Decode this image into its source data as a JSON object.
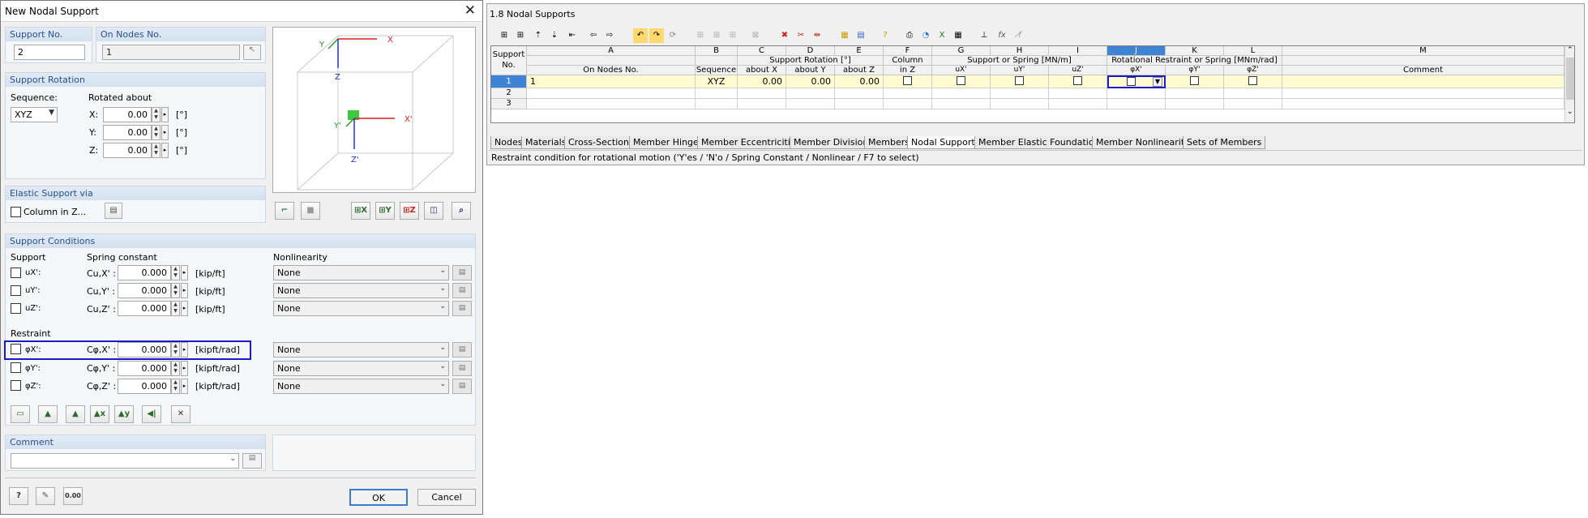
{
  "dialog": {
    "title": "New Nodal Support",
    "support_no_label": "Support No.",
    "support_no_value": "2",
    "on_nodes_label": "On Nodes No.",
    "on_nodes_value": "1",
    "rotation": {
      "title": "Support Rotation",
      "sequence_label": "Sequence:",
      "sequence_value": "XYZ",
      "rotated_about_label": "Rotated about",
      "rows": [
        {
          "axis": "X:",
          "value": "0.00",
          "unit": "[°]"
        },
        {
          "axis": "Y:",
          "value": "0.00",
          "unit": "[°]"
        },
        {
          "axis": "Z:",
          "value": "0.00",
          "unit": "[°]"
        }
      ]
    },
    "axes": {
      "x": "X",
      "y": "Y",
      "z": "Z",
      "xp": "X'",
      "yp": "Y'",
      "zp": "Z'"
    },
    "elastic": {
      "title": "Elastic Support via",
      "column_label": "Column in Z..."
    },
    "conditions": {
      "title": "Support Conditions",
      "support_label": "Support",
      "spring_label": "Spring constant",
      "nonlinearity_label": "Nonlinearity",
      "restraint_label": "Restraint",
      "rows": [
        {
          "dof": "uX':",
          "sym": "Cu,X' :",
          "value": "0.000",
          "unit": "[kip/ft]",
          "nonlin": "None"
        },
        {
          "dof": "uY':",
          "sym": "Cu,Y' :",
          "value": "0.000",
          "unit": "[kip/ft]",
          "nonlin": "None"
        },
        {
          "dof": "uZ':",
          "sym": "Cu,Z' :",
          "value": "0.000",
          "unit": "[kip/ft]",
          "nonlin": "None"
        },
        {
          "dof": "φX':",
          "sym": "Cφ,X' :",
          "value": "0.000",
          "unit": "[kipft/rad]",
          "nonlin": "None"
        },
        {
          "dof": "φY':",
          "sym": "Cφ,Y' :",
          "value": "0.000",
          "unit": "[kipft/rad]",
          "nonlin": "None"
        },
        {
          "dof": "φZ':",
          "sym": "Cφ,Z' :",
          "value": "0.000",
          "unit": "[kipft/rad]",
          "nonlin": "None"
        }
      ]
    },
    "comment_label": "Comment",
    "ok_label": "OK",
    "cancel_label": "Cancel",
    "decimals_icon_text": "0.00"
  },
  "table": {
    "title": "1.8 Nodal Supports",
    "col_letters": [
      "A",
      "B",
      "C",
      "D",
      "E",
      "F",
      "G",
      "H",
      "I",
      "J",
      "K",
      "L",
      "M"
    ],
    "support_no_header": "Support No.",
    "group_headers": {
      "rotation": "Support Rotation [°]",
      "column": "Column",
      "support_spring": "Support or Spring [MN/m]",
      "rot_restraint": "Rotational Restraint or Spring [MNm/rad]"
    },
    "headers": [
      "On Nodes No.",
      "Sequence",
      "about X",
      "about Y",
      "about Z",
      "in Z",
      "uX'",
      "uY'",
      "uZ'",
      "φX'",
      "φY'",
      "φZ'",
      "Comment"
    ],
    "rows": [
      {
        "no": "1",
        "nodes": "1",
        "seq": "XYZ",
        "rx": "0.00",
        "ry": "0.00",
        "rz": "0.00"
      },
      {
        "no": "2",
        "nodes": "",
        "seq": "",
        "rx": "",
        "ry": "",
        "rz": ""
      },
      {
        "no": "3",
        "nodes": "",
        "seq": "",
        "rx": "",
        "ry": "",
        "rz": ""
      }
    ],
    "tabs": [
      "Nodes",
      "Materials",
      "Cross-Sections",
      "Member Hinges",
      "Member Eccentricities",
      "Member Divisions",
      "Members",
      "Nodal Supports",
      "Member Elastic Foundations",
      "Member Nonlinearities",
      "Sets of Members"
    ],
    "active_tab": "Nodal Supports",
    "status": "Restraint condition for rotational motion ('Y'es / 'N'o / Spring Constant / Nonlinear / F7 to select)",
    "fx_label": "fx"
  },
  "colors": {
    "highlight": "#1a1acc",
    "row_yellow": "#fffbd0",
    "header_blue": "#2c4f88"
  }
}
